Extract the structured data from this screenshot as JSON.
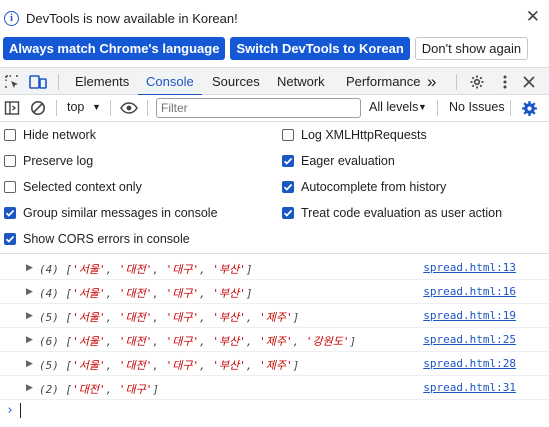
{
  "infobar": {
    "message": "DevTools is now available in Korean!",
    "buttons": {
      "match_language": "Always match Chrome's language",
      "switch_korean": "Switch DevTools to Korean",
      "dont_show": "Don't show again"
    },
    "close_glyph": "✕"
  },
  "tabs": {
    "items": [
      "Elements",
      "Console",
      "Sources",
      "Network",
      "Performance"
    ],
    "active": "Console",
    "more_glyph": "»"
  },
  "toolbar": {
    "context": "top",
    "filter_placeholder": "Filter",
    "levels": "All levels",
    "issues": "No Issues"
  },
  "settings": {
    "left": [
      {
        "label": "Hide network",
        "checked": false
      },
      {
        "label": "Preserve log",
        "checked": false
      },
      {
        "label": "Selected context only",
        "checked": false
      },
      {
        "label": "Group similar messages in console",
        "checked": true
      },
      {
        "label": "Show CORS errors in console",
        "checked": true
      }
    ],
    "right": [
      {
        "label": "Log XMLHttpRequests",
        "checked": false
      },
      {
        "label": "Eager evaluation",
        "checked": true
      },
      {
        "label": "Autocomplete from history",
        "checked": true
      },
      {
        "label": "Treat code evaluation as user action",
        "checked": true
      }
    ]
  },
  "messages": [
    {
      "count": "(4)",
      "items": [
        "서울",
        "대전",
        "대구",
        "부산"
      ],
      "source": "spread.html:13"
    },
    {
      "count": "(4)",
      "items": [
        "서울",
        "대전",
        "대구",
        "부산"
      ],
      "source": "spread.html:16"
    },
    {
      "count": "(5)",
      "items": [
        "서울",
        "대전",
        "대구",
        "부산",
        "제주"
      ],
      "source": "spread.html:19"
    },
    {
      "count": "(6)",
      "items": [
        "서울",
        "대전",
        "대구",
        "부산",
        "제주",
        "강원도"
      ],
      "source": "spread.html:25"
    },
    {
      "count": "(5)",
      "items": [
        "서울",
        "대전",
        "대구",
        "부산",
        "제주"
      ],
      "source": "spread.html:28"
    },
    {
      "count": "(2)",
      "items": [
        "대전",
        "대구"
      ],
      "source": "spread.html:31"
    }
  ],
  "colors": {
    "accent": "#1a56c4",
    "button_primary": "#1558d6",
    "string": "#c80000"
  }
}
